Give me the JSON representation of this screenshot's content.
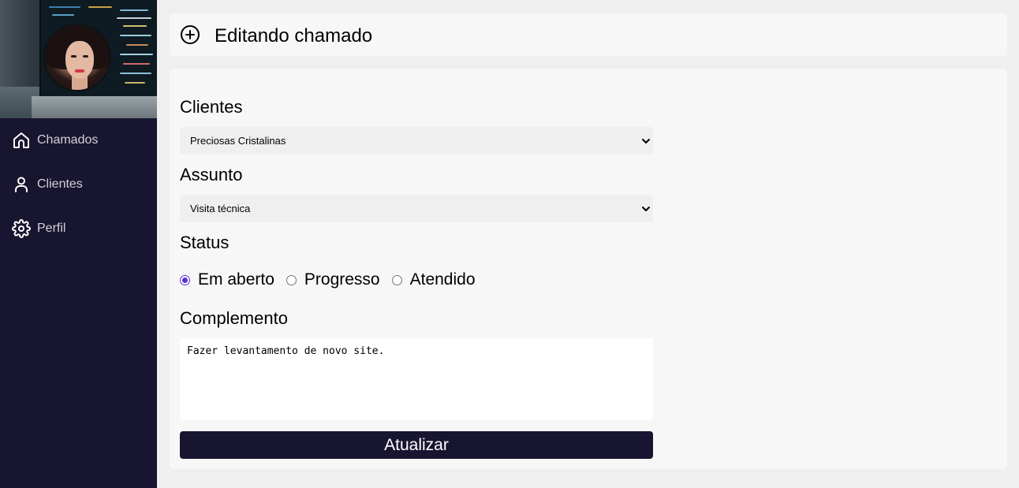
{
  "sidebar": {
    "items": [
      {
        "label": "Chamados",
        "icon": "home-icon"
      },
      {
        "label": "Clientes",
        "icon": "user-icon"
      },
      {
        "label": "Perfil",
        "icon": "gear-icon"
      }
    ]
  },
  "header": {
    "icon": "plus-circle-icon",
    "title": "Editando chamado"
  },
  "form": {
    "clientes_label": "Clientes",
    "clientes_value": "Preciosas Cristalinas",
    "assunto_label": "Assunto",
    "assunto_value": "Visita técnica",
    "status_label": "Status",
    "status_options": [
      {
        "label": "Em aberto",
        "checked": true
      },
      {
        "label": "Progresso",
        "checked": false
      },
      {
        "label": "Atendido",
        "checked": false
      }
    ],
    "complemento_label": "Complemento",
    "complemento_value": "Fazer levantamento de novo site.",
    "submit_label": "Atualizar"
  },
  "colors": {
    "sidebar_bg": "#181530",
    "accent": "#5a30d8",
    "button_bg": "#181530"
  }
}
